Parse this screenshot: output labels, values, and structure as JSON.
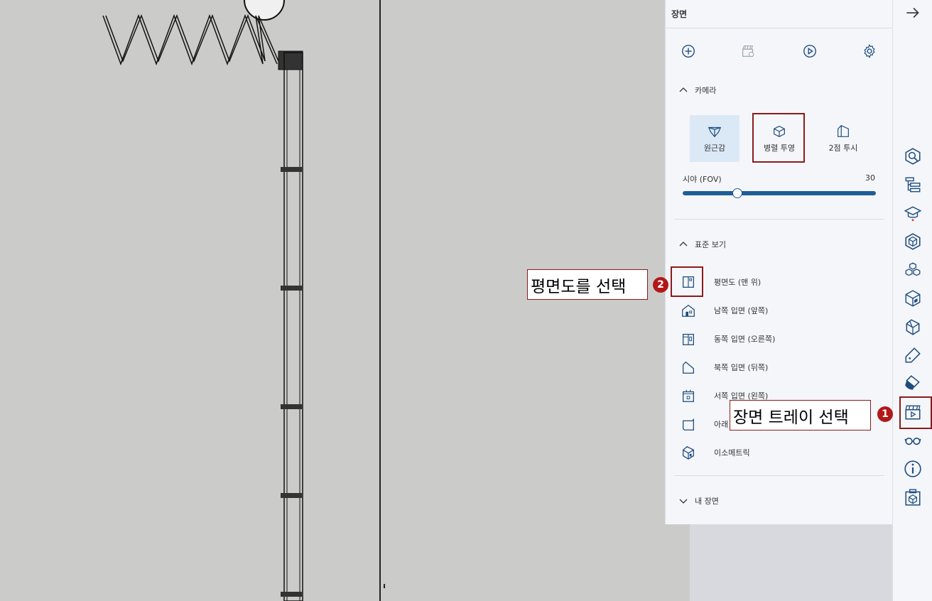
{
  "panel": {
    "title": "장면",
    "tools": [
      {
        "name": "add-scene-icon"
      },
      {
        "name": "scene-clapper-icon"
      },
      {
        "name": "play-icon"
      },
      {
        "name": "gear-icon"
      }
    ],
    "camera": {
      "header": "카메라",
      "buttons": [
        {
          "label": "원근감",
          "icon": "perspective-icon",
          "active": true
        },
        {
          "label": "병렬 투영",
          "icon": "parallel-projection-icon",
          "active": false
        },
        {
          "label": "2점 투시",
          "icon": "two-point-perspective-icon",
          "active": false
        }
      ],
      "fov_label": "시야 (FOV)",
      "fov_value": "30",
      "fov_fraction": 0.27
    },
    "standard_views": {
      "header": "표준 보기",
      "items": [
        {
          "label": "평면도 (맨 위)",
          "icon": "top-view-icon"
        },
        {
          "label": "남쪽 입면 (앞쪽)",
          "icon": "front-view-icon"
        },
        {
          "label": "동쪽 입면 (오른쪽)",
          "icon": "right-view-icon"
        },
        {
          "label": "북쪽 입면 (뒤쪽)",
          "icon": "back-view-icon"
        },
        {
          "label": "서쪽 입면 (왼쪽)",
          "icon": "left-view-icon"
        },
        {
          "label": "아래",
          "icon": "bottom-view-icon"
        },
        {
          "label": "이소메트릭",
          "icon": "isometric-view-icon"
        }
      ]
    },
    "my_scenes": {
      "header": "내 장면"
    }
  },
  "strip": {
    "collapse_icon": "arrow-right-icon",
    "icons": [
      "entity-info-icon",
      "outliner-icon",
      "instructor-icon",
      "components-icon",
      "materials-icon",
      "styles-icon",
      "tags-icon",
      "soften-edges-icon",
      "shadows-icon",
      "scenes-icon",
      "display-icon",
      "info-icon",
      "model-info-icon"
    ]
  },
  "annotations": {
    "callout_1": "장면 트레이 선택",
    "callout_2": "평면도를 선택",
    "badge_1": "1",
    "badge_2": "2",
    "colors": {
      "annotation": "#8b1b1b",
      "badge": "#b21818",
      "accent": "#1e5d99"
    }
  }
}
